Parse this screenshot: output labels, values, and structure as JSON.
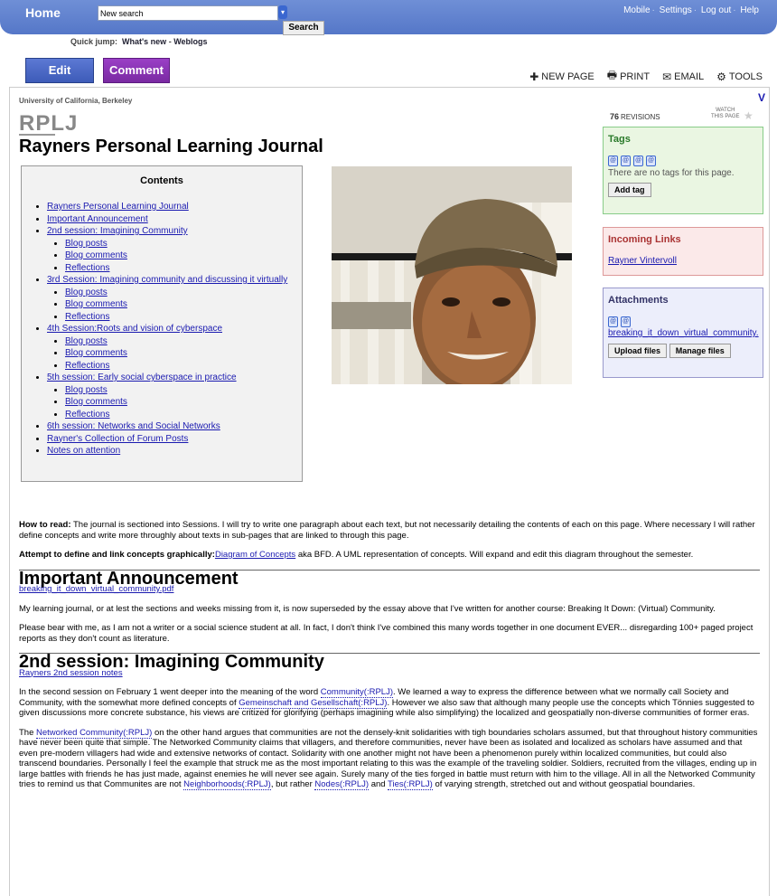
{
  "topbar": {
    "home": "Home",
    "search_value": "New search",
    "search_button": "Search",
    "links": [
      "Mobile",
      "Settings",
      "Log out",
      "Help"
    ]
  },
  "quickjump": {
    "label": "Quick jump:",
    "links": [
      "What's new",
      "Weblogs"
    ]
  },
  "toolbar": {
    "edit": "Edit",
    "comment": "Comment",
    "actions": [
      {
        "icon": "plus-icon",
        "label": "NEW PAGE"
      },
      {
        "icon": "printer-icon",
        "label": "PRINT"
      },
      {
        "icon": "email-icon",
        "label": "EMAIL"
      },
      {
        "icon": "gear-icon",
        "label": "TOOLS"
      }
    ]
  },
  "page": {
    "region": "University of California, Berkeley",
    "site": "RPLJ",
    "title": "Rayners Personal Learning Journal",
    "corner": "V"
  },
  "toc": {
    "title": "Contents",
    "items": [
      {
        "label": "Rayners Personal Learning Journal",
        "children": []
      },
      {
        "label": "Important Announcement",
        "children": []
      },
      {
        "label": "2nd session: Imagining Community",
        "children": [
          "Blog posts",
          "Blog comments",
          "Reflections"
        ]
      },
      {
        "label": "3rd Session: Imagining community and discussing it virtually",
        "children": [
          "Blog posts",
          "Blog comments",
          "Reflections"
        ]
      },
      {
        "label": "4th Session:Roots and vision of cyberspace",
        "children": [
          "Blog posts",
          "Blog comments",
          "Reflections"
        ]
      },
      {
        "label": "5th session: Early social cyberspace in practice",
        "children": [
          "Blog posts",
          "Blog comments",
          "Reflections"
        ]
      },
      {
        "label": "6th session: Networks and Social Networks",
        "children": []
      },
      {
        "label": "Rayner's Collection of Forum Posts",
        "children": []
      },
      {
        "label": "Notes on attention",
        "children": []
      }
    ]
  },
  "sidebar": {
    "revisions_count": "76",
    "revisions_label": "REVISIONS",
    "watch_label_1": "WATCH",
    "watch_label_2": "THIS PAGE",
    "tags": {
      "title": "Tags",
      "empty": "There are no tags for this page.",
      "add": "Add tag"
    },
    "incoming": {
      "title": "Incoming Links",
      "link": "Rayner Vintervoll"
    },
    "attachments": {
      "title": "Attachments",
      "file": "breaking_it_down_virtual_community.",
      "upload": "Upload files",
      "manage": "Manage files"
    }
  },
  "content": {
    "howto_label": "How to read:",
    "howto_text": " The journal is sectioned into Sessions. I will try to write one paragraph about each text, but not necessarily detailing the contents of each on this page. Where necessary I will rather define concepts and write more throughly about texts in sub-pages that are linked to through this page.",
    "attempt_label": "Attempt to define and link concepts graphically:",
    "attempt_link": "Diagram of Concepts",
    "attempt_text": " aka BFD. A UML representation of concepts. Will expand and edit this diagram throughout the semester.",
    "announce_title": "Important Announcement",
    "announce_link": "breaking_it_down_virtual_community.pdf",
    "announce_p1": "My learning journal, or at lest the sections and weeks missing from it, is now superseded by the essay above that I've written for another course: Breaking It Down: (Virtual) Community.",
    "announce_p2": "Please bear with me, as I am not a writer or a social science student at all. In fact, I don't think I've combined this many words together in one document EVER... disregarding 100+ paged project reports as they don't count as literature.",
    "session2_title": "2nd session: Imagining Community",
    "session2_link": "Rayners 2nd session notes",
    "s2p1_a": "In the second session on February 1 went deeper into the meaning of the word ",
    "s2p1_l1": "Community(:RPLJ)",
    "s2p1_b": ". We learned a way to express the difference between what we normally call Society and Community, with the somewhat more defined concepts of ",
    "s2p1_l2": "Gemeinschaft and Gesellschaft(:RPLJ)",
    "s2p1_c": ". However we also saw that although many people use the concepts which Tönnies suggested to given discussions more concrete substance, his views are critized for glorifying (perhaps imagining while also simplifying) the localized and geospatially non-diverse communities of former eras.",
    "s2p2_a": "The ",
    "s2p2_l1": "Networked Community(:RPLJ)",
    "s2p2_b": " on the other hand argues that communities are not the densely-knit solidarities with tigh boundaries scholars assumed, but that throughout history communities have never been quite that simple. The Networked Community claims that villagers, and therefore communities, never have been as isolated and localized as scholars have assumed and that even pre-modern villagers had wide and extensive networks of contact. Solidarity with one another might not have been a phenomenon purely within localized communities, but could also transcend boundaries. Personally I feel the example that struck me as the most important relating to this was the example of the traveling soldier. Soldiers, recruited from the villages, ending up in large battles with friends he has just made, against enemies he will never see again. Surely many of the ties forged in battle must return with him to the village. All in all the Networked Community tries to remind us that Communites are not ",
    "s2p2_l2": "Neighborhoods(:RPLJ)",
    "s2p2_c": ", but rather ",
    "s2p2_l3": "Nodes(:RPLJ)",
    "s2p2_d": " and ",
    "s2p2_l4": "Ties(:RPLJ)",
    "s2p2_e": " of varying strength, stretched out and without geospatial boundaries."
  }
}
